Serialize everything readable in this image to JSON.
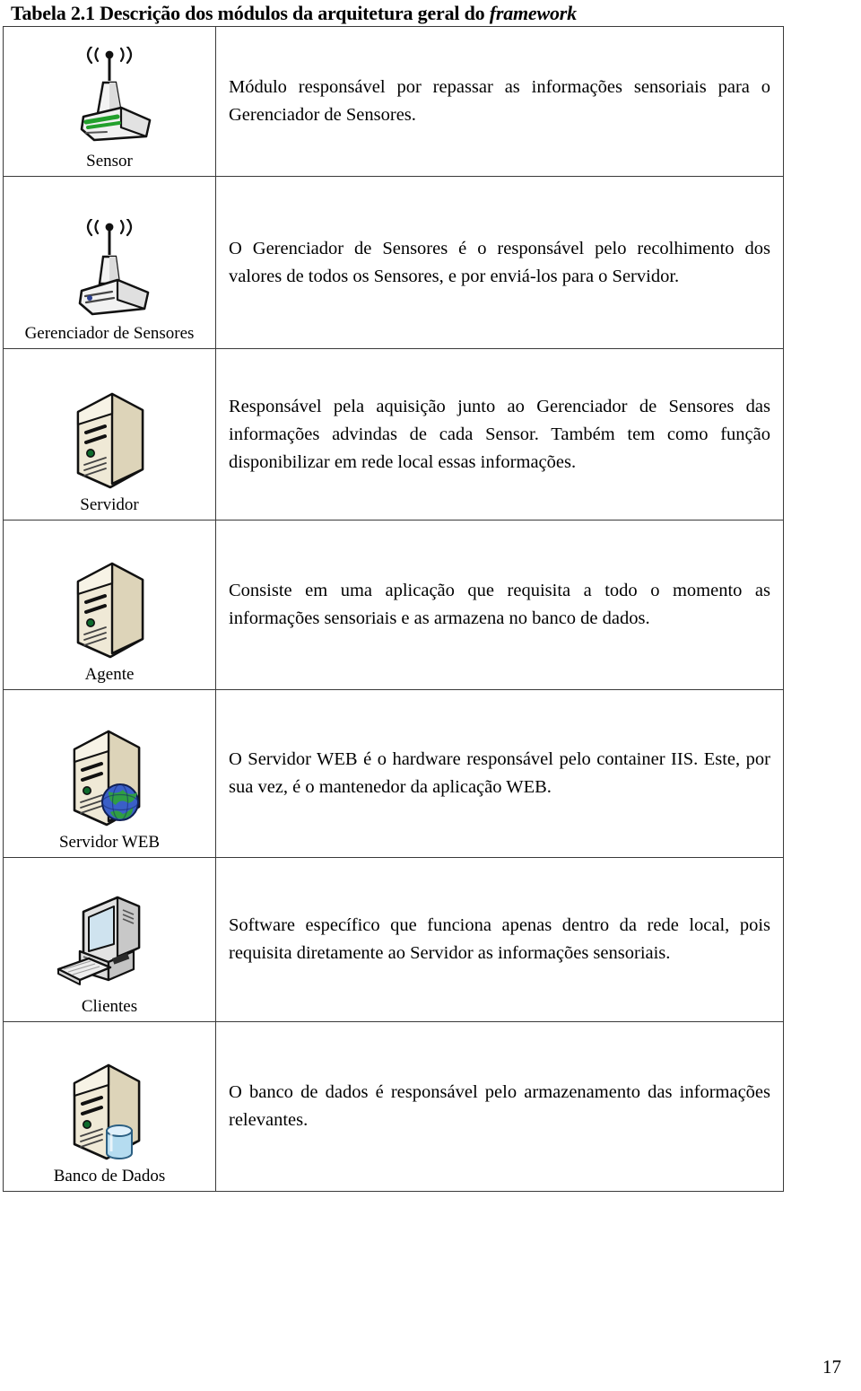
{
  "caption": {
    "prefix": "Tabela 2.1 Descrição dos módulos da arquitetura geral do ",
    "italic_word": "framework"
  },
  "page_number": "17",
  "colors": {
    "border": "#3a3a3a",
    "server_body": "#e8dfc8",
    "server_light": "#f6f1e2",
    "server_shadow": "#c9bfa4",
    "globe_blue": "#3a5fc8",
    "globe_green": "#2f9e44",
    "db_cylinder": "#9fd2ee",
    "sensor_green": "#22a02c",
    "pc_body": "#d8d8d8",
    "pc_screen": "#cfe3ef"
  },
  "rows": [
    {
      "icon": "sensor-antenna-icon",
      "label": "Sensor",
      "description": "Módulo responsável por repassar as informações sensoriais para o Gerenciador de Sensores."
    },
    {
      "icon": "sensor-manager-antenna-icon",
      "label": "Gerenciador de Sensores",
      "description": "O Gerenciador de Sensores é o responsável pelo recolhimento dos valores de todos os Sensores, e por enviá-los para o Servidor."
    },
    {
      "icon": "server-tower-icon",
      "label": "Servidor",
      "description": "Responsável pela aquisição junto ao Gerenciador de Sensores das informações advindas de cada Sensor. Também tem como função disponibilizar em rede local essas informações."
    },
    {
      "icon": "agent-server-icon",
      "label": "Agente",
      "description": "Consiste em uma aplicação que requisita a todo o momento as informações sensoriais e as armazena no banco de dados."
    },
    {
      "icon": "web-server-globe-icon",
      "label": "Servidor WEB",
      "description": "O Servidor WEB é o hardware responsável pelo container IIS. Este, por sua vez, é o mantenedor da aplicação WEB."
    },
    {
      "icon": "desktop-computer-icon",
      "label": "Clientes",
      "description": "Software específico que funciona apenas dentro da rede local, pois requisita diretamente ao Servidor as informações sensoriais."
    },
    {
      "icon": "database-server-icon",
      "label": "Banco de Dados",
      "description": "O banco de dados é responsável pelo armazenamento das informações relevantes."
    }
  ]
}
